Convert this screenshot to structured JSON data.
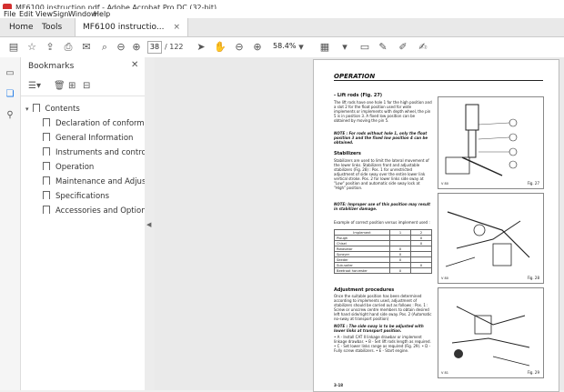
{
  "window": {
    "title": "MF6100 instruction.pdf - Adobe Acrobat Pro DC (32-bit)"
  },
  "menu": [
    "File",
    "Edit",
    "View",
    "Sign",
    "Window",
    "Help"
  ],
  "tabs": [
    {
      "label": "Home"
    },
    {
      "label": "Tools"
    },
    {
      "label": "MF6100 instructio..."
    }
  ],
  "toolbar": {
    "page_current": "38",
    "page_total": "/ 122",
    "zoom": "58.4%"
  },
  "bookmarks": {
    "title": "Bookmarks",
    "items": [
      {
        "label": "Contents"
      },
      {
        "label": "Declaration of conformity"
      },
      {
        "label": "General Information"
      },
      {
        "label": "Instruments and controls"
      },
      {
        "label": "Operation"
      },
      {
        "label": "Maintenance and Adjustments"
      },
      {
        "label": "Specifications"
      },
      {
        "label": "Accessories and Options"
      }
    ]
  },
  "page": {
    "section": "OPERATION",
    "lift_rods_heading": "- Lift rods (Fig. 27)",
    "lift_rods_text": "The lift rods have one hole 1 for the high position and a slot 2 for the float position used for wide implements or implements with depth wheel, the pin 5 is in position 3. A fixed low position can be obtained by moving the pin 5.",
    "lift_rods_note": "NOTE : For rods without hole 1, only the float position 3 and the fixed low position 4 can be obtained.",
    "stabilizers_heading": "Stabilizers",
    "stabilizers_text": "Stabilizers are used to limit the lateral movement of the lower links. Stabilizers front and adjustable stabilizers (Fig. 28) : Pos. 1 for unrestricted adjustment of side sway over the entire lower link vertical stroke. Pos. 2 for lower links side sway at \"Low\" position and automatic side sway lock at \"High\" position.",
    "stabilizers_note": "NOTE: Improper use of this position may result in stabilizer damage.",
    "example_text": "Example of correct position versus implement used :",
    "table": {
      "headers": [
        "Implement",
        "1",
        "2"
      ],
      "rows": [
        [
          "Plough",
          "",
          "X"
        ],
        [
          "Chisel",
          "",
          "X"
        ],
        [
          "Rotavator",
          "X",
          ""
        ],
        [
          "Sprayer",
          "X",
          ""
        ],
        [
          "Seeder",
          "X",
          ""
        ],
        [
          "Sub-soiler",
          "",
          "X"
        ],
        [
          "Beetroot harvester",
          "X",
          ""
        ]
      ]
    },
    "adjust_heading": "Adjustment procedures",
    "adjust_text": "Once the suitable position has been determined according to implements used, adjustment of stabilizers should be carried out as follows : Pos. 1 : Screw or unscrew centre members to obtain desired left hand side/right hand side sway. Pos. 2 (Automatic no-sway at transport position)",
    "adjust_note": "NOTE : The side sway is to be adjusted with lower links at transport position.",
    "adjust_steps": "• A - Install CAT II linkage drawbar or implement linkage drawbar. • B - Set lift rods length as required. • C - Set lower links range as required (Fig. 29). • D - Fully screw stabilizers. • E - Start engine.",
    "fig27": "Fig. 27",
    "fig28": "Fig. 28",
    "fig29": "Fig. 29",
    "fig27_code": "V 80",
    "fig28_code": "V 80",
    "fig29_code": "V 81",
    "page_number": "3-18"
  }
}
